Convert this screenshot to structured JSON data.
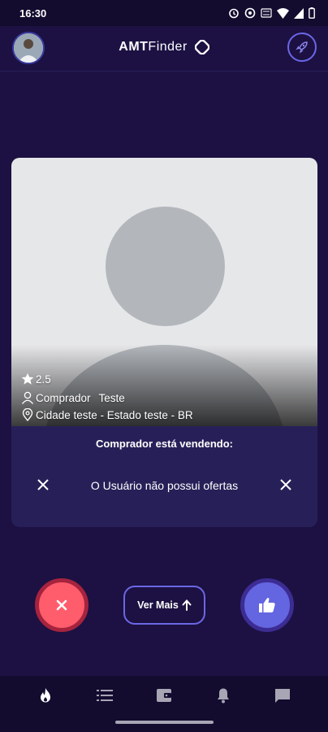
{
  "status_bar": {
    "time": "16:30",
    "icons": [
      "alarm-icon",
      "eye-icon",
      "volte-icon",
      "wifi-icon",
      "signal-icon",
      "battery-icon"
    ]
  },
  "header": {
    "logo_bold": "AMT",
    "logo_light": "Finder",
    "avatar_icon": "user-photo",
    "action_icon": "rocket-icon"
  },
  "profile": {
    "rating": "2.5",
    "role": "Comprador",
    "name": "Teste",
    "location": "Cidade teste - Estado teste - BR"
  },
  "offers": {
    "title": "Comprador está vendendo:",
    "empty_message": "O Usuário não possui ofertas"
  },
  "actions": {
    "more_label": "Ver Mais"
  },
  "bottom_nav": {
    "items": [
      "flame-icon",
      "list-icon",
      "wallet-icon",
      "bell-icon",
      "chat-icon"
    ]
  },
  "colors": {
    "background": "#1c1142",
    "accent": "#6465e1",
    "dislike": "#ff5c6c"
  }
}
